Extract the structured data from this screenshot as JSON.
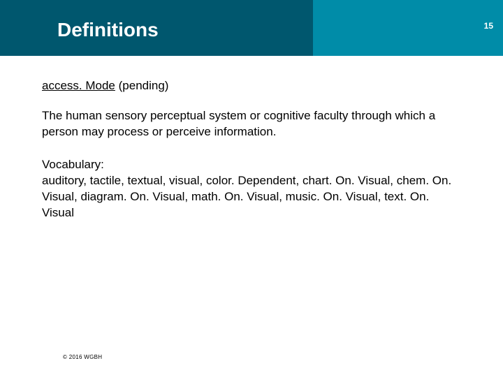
{
  "header": {
    "title": "Definitions",
    "slide_number": "15"
  },
  "content": {
    "term": "access. Mode",
    "status": "(pending)",
    "definition": "The human sensory perceptual system or cognitive faculty through which a person may process or perceive information.",
    "vocab_label": "Vocabulary:",
    "vocab_list": "auditory, tactile, textual, visual, color. Dependent, chart. On. Visual, chem. On. Visual, diagram. On. Visual, math. On. Visual, music. On. Visual, text. On. Visual"
  },
  "footer": {
    "copyright": "© 2016 WGBH"
  }
}
